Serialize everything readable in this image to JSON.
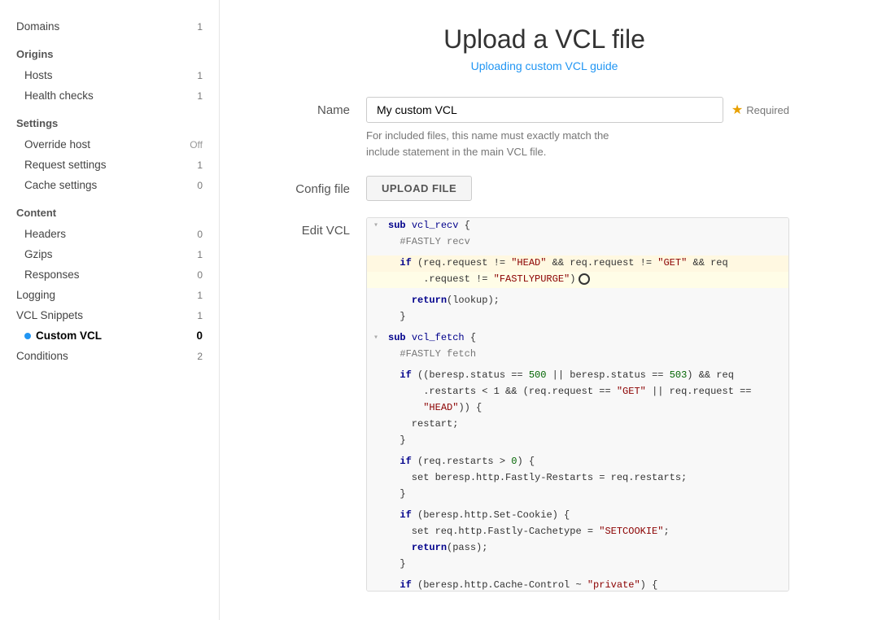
{
  "sidebar": {
    "domains_label": "Domains",
    "domains_count": "1",
    "origins_label": "Origins",
    "hosts_label": "Hosts",
    "hosts_count": "1",
    "health_checks_label": "Health checks",
    "health_checks_count": "1",
    "settings_label": "Settings",
    "override_host_label": "Override host",
    "override_host_value": "Off",
    "request_settings_label": "Request settings",
    "request_settings_count": "1",
    "cache_settings_label": "Cache settings",
    "cache_settings_count": "0",
    "content_label": "Content",
    "headers_label": "Headers",
    "headers_count": "0",
    "gzips_label": "Gzips",
    "gzips_count": "1",
    "responses_label": "Responses",
    "responses_count": "0",
    "logging_label": "Logging",
    "logging_count": "1",
    "vcl_snippets_label": "VCL Snippets",
    "vcl_snippets_count": "1",
    "custom_vcl_label": "Custom VCL",
    "custom_vcl_count": "0",
    "conditions_label": "Conditions",
    "conditions_count": "2"
  },
  "main": {
    "page_title": "Upload a VCL file",
    "page_subtitle_link": "Uploading custom VCL guide",
    "name_label": "Name",
    "name_value": "My custom VCL",
    "name_placeholder": "",
    "required_label": "Required",
    "hint_text": "For included files, this name must exactly match the\ninclude statement in the main VCL file.",
    "config_file_label": "Config file",
    "upload_btn_label": "UPLOAD FILE",
    "edit_vcl_label": "Edit VCL"
  }
}
